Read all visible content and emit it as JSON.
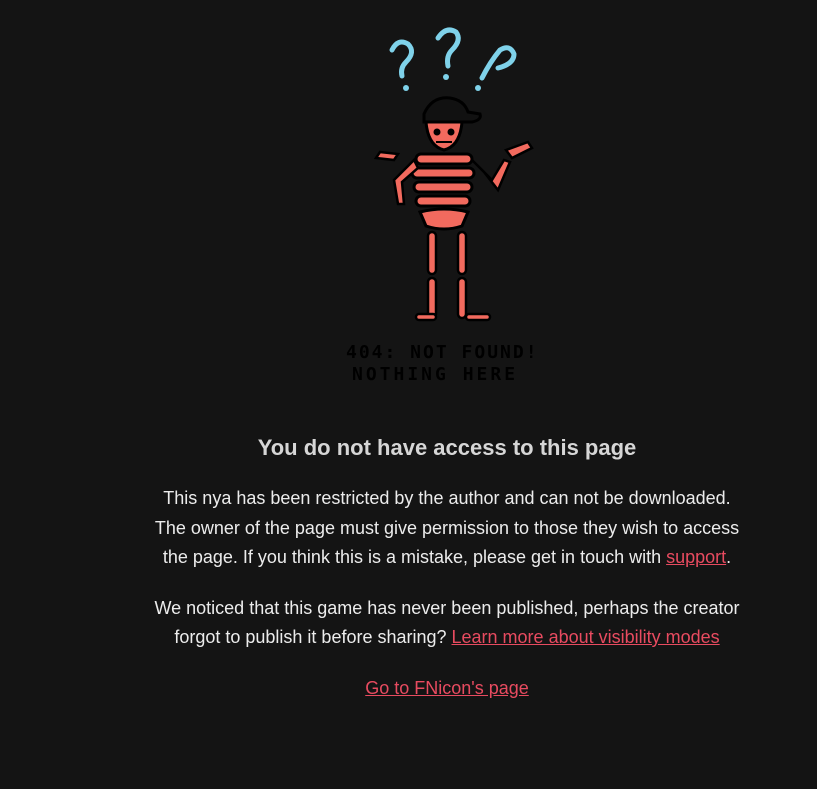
{
  "illustration": {
    "caption_line1": "404: NOT FOUND!",
    "caption_line2": "NOTHING HERE",
    "icon": "confused-skeleton-icon",
    "colors": {
      "skeleton": "#f26a5e",
      "question_marks": "#7fd2ea",
      "outline": "#000000"
    }
  },
  "message": {
    "title": "You do not have access to this page",
    "p1_text": "This nya has been restricted by the author and can not be downloaded. The owner of the page must give permission to those they wish to access the page. If you think this is a mistake, please get in touch with ",
    "support_link": "support",
    "p1_end": ".",
    "p2_text": "We noticed that this game has never been published, perhaps the creator forgot to publish it before sharing? ",
    "visibility_link": "Learn more about visibility modes",
    "home_link": "Go to FNicon's page"
  },
  "theme": {
    "background": "#141414",
    "text": "#ececec",
    "link": "#e84b60"
  }
}
